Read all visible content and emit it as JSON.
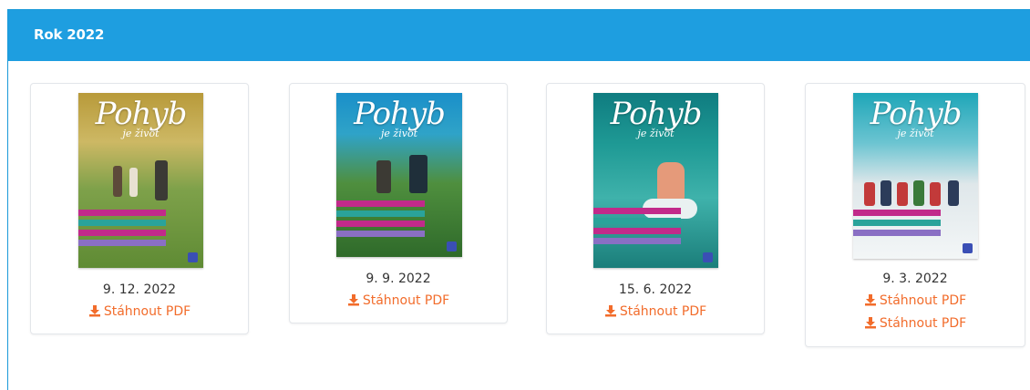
{
  "panel": {
    "title": "Rok 2022",
    "header_color": "#1e9ee0"
  },
  "issues": [
    {
      "date": "9. 12. 2022",
      "cover_brand": "Pohyb",
      "cover_sub": "je život",
      "links": [
        "Stáhnout PDF"
      ]
    },
    {
      "date": "9. 9. 2022",
      "cover_brand": "Pohyb",
      "cover_sub": "je život",
      "links": [
        "Stáhnout PDF"
      ]
    },
    {
      "date": "15. 6. 2022",
      "cover_brand": "Pohyb",
      "cover_sub": "je život",
      "links": [
        "Stáhnout PDF"
      ]
    },
    {
      "date": "9. 3. 2022",
      "cover_brand": "Pohyb",
      "cover_sub": "je život",
      "links": [
        "Stáhnout PDF",
        "Stáhnout PDF"
      ]
    }
  ],
  "colors": {
    "link": "#f26c2b",
    "accent": "#1e9ee0"
  },
  "icons": {
    "download": "download-icon"
  }
}
